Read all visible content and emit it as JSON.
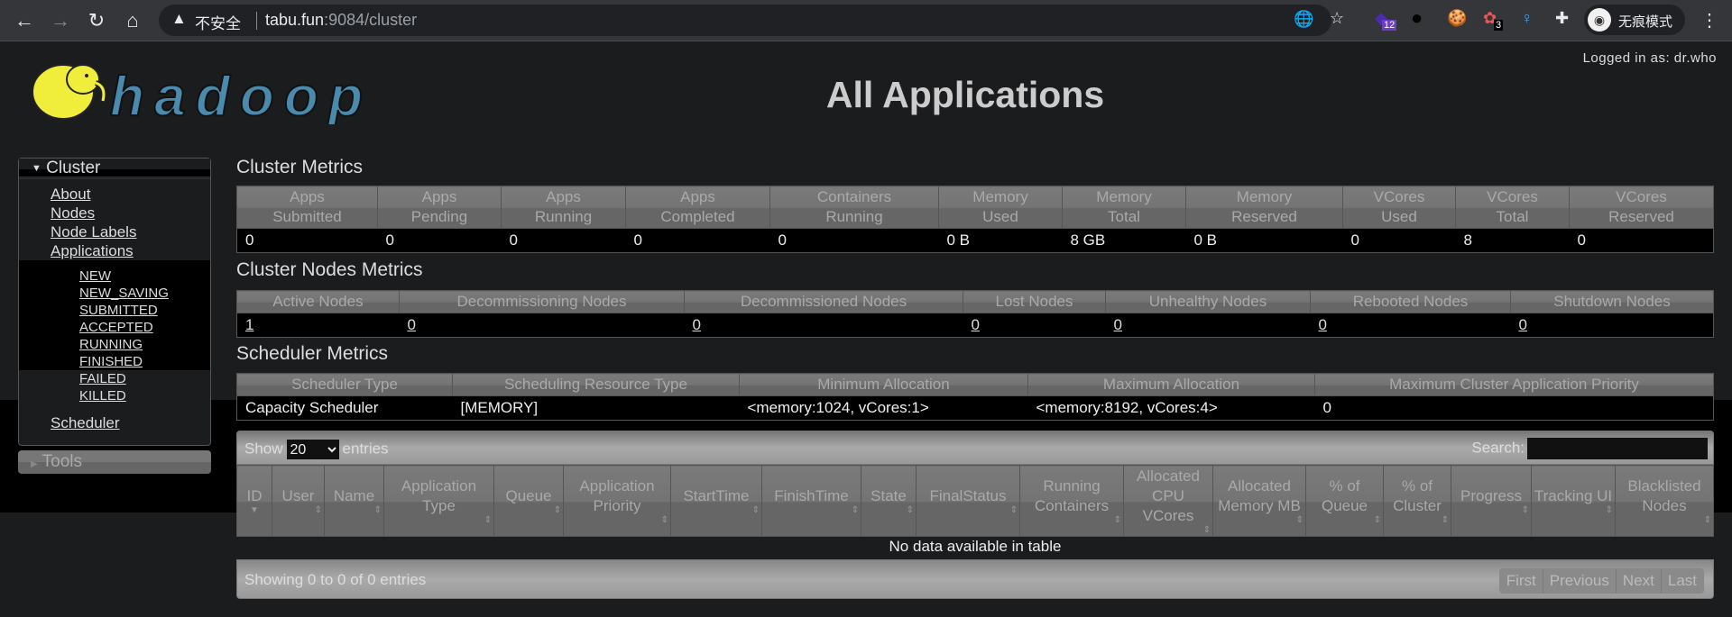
{
  "browser": {
    "insecure_label": "不安全",
    "url_host": "tabu.fun",
    "url_rest": ":9084/cluster",
    "ext_badge_1": "12",
    "ext_badge_2": "3",
    "incognito_label": "无痕模式"
  },
  "header": {
    "logged_in": "Logged in as: dr.who",
    "title": "All Applications",
    "logo_text": "hadoop"
  },
  "sidebar": {
    "cluster_label": "Cluster",
    "items": [
      "About",
      "Nodes",
      "Node Labels",
      "Applications"
    ],
    "app_states": [
      "NEW",
      "NEW_SAVING",
      "SUBMITTED",
      "ACCEPTED",
      "RUNNING",
      "FINISHED",
      "FAILED",
      "KILLED"
    ],
    "scheduler": "Scheduler",
    "tools_label": "Tools"
  },
  "cluster_metrics": {
    "title": "Cluster Metrics",
    "headers": [
      [
        "Apps",
        "Submitted"
      ],
      [
        "Apps",
        "Pending"
      ],
      [
        "Apps",
        "Running"
      ],
      [
        "Apps",
        "Completed"
      ],
      [
        "Containers",
        "Running"
      ],
      [
        "Memory",
        "Used"
      ],
      [
        "Memory",
        "Total"
      ],
      [
        "Memory",
        "Reserved"
      ],
      [
        "VCores",
        "Used"
      ],
      [
        "VCores",
        "Total"
      ],
      [
        "VCores",
        "Reserved"
      ]
    ],
    "values": [
      "0",
      "0",
      "0",
      "0",
      "0",
      "0 B",
      "8 GB",
      "0 B",
      "0",
      "8",
      "0"
    ]
  },
  "nodes_metrics": {
    "title": "Cluster Nodes Metrics",
    "headers": [
      "Active Nodes",
      "Decommissioning Nodes",
      "Decommissioned Nodes",
      "Lost Nodes",
      "Unhealthy Nodes",
      "Rebooted Nodes",
      "Shutdown Nodes"
    ],
    "values": [
      "1",
      "0",
      "0",
      "0",
      "0",
      "0",
      "0"
    ]
  },
  "scheduler_metrics": {
    "title": "Scheduler Metrics",
    "headers": [
      "Scheduler Type",
      "Scheduling Resource Type",
      "Minimum Allocation",
      "Maximum Allocation",
      "Maximum Cluster Application Priority"
    ],
    "values": [
      "Capacity Scheduler",
      "[MEMORY]",
      "<memory:1024, vCores:1>",
      "<memory:8192, vCores:4>",
      "0"
    ]
  },
  "apps_table": {
    "show_label": "Show",
    "entries_label": "entries",
    "page_size": "20",
    "search_label": "Search:",
    "search_value": "",
    "headers": [
      "ID",
      "User",
      "Name",
      "Application Type",
      "Queue",
      "Application Priority",
      "StartTime",
      "FinishTime",
      "State",
      "FinalStatus",
      "Running Containers",
      "Allocated CPU VCores",
      "Allocated Memory MB",
      "% of Queue",
      "% of Cluster",
      "Progress",
      "Tracking UI",
      "Blacklisted Nodes"
    ],
    "empty_message": "No data available in table",
    "info": "Showing 0 to 0 of 0 entries",
    "pager": [
      "First",
      "Previous",
      "Next",
      "Last"
    ]
  }
}
